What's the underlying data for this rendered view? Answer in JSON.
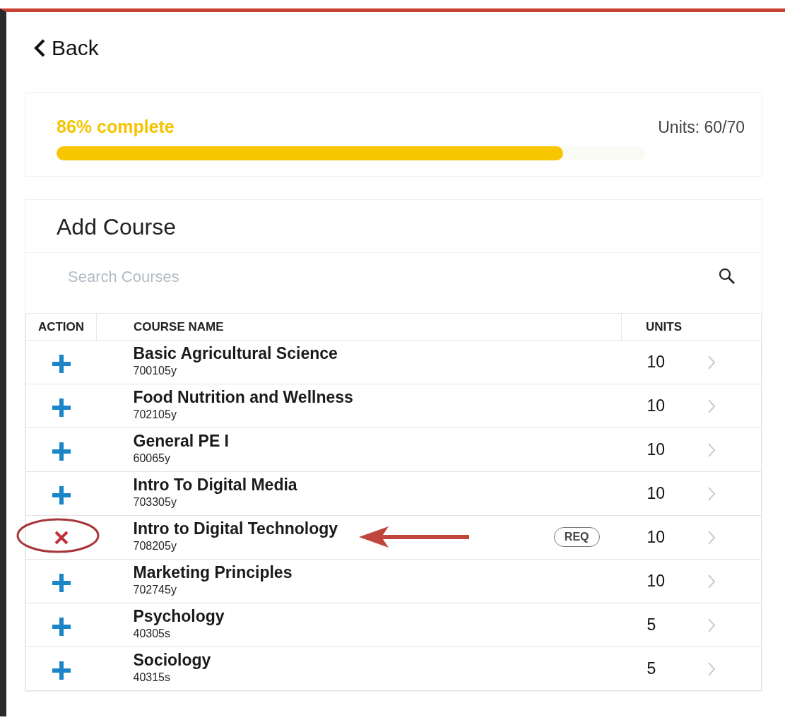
{
  "back": {
    "label": "Back"
  },
  "progress": {
    "label": "86% complete",
    "units": "Units: 60/70",
    "level": 0.86
  },
  "add_course": {
    "title": "Add Course",
    "search": {
      "placeholder": "Search Courses"
    },
    "table": {
      "columns": [
        "ACTION",
        "COURSE NAME",
        "UNITS"
      ],
      "rows": [
        {
          "kind": "add",
          "name": "Basic Agricultural Science",
          "code": "700105y",
          "units": "10",
          "marked": false
        },
        {
          "kind": "add",
          "name": "Food Nutrition and Wellness",
          "code": "702105y",
          "units": "10",
          "marked": false
        },
        {
          "kind": "add",
          "name": "General PE I",
          "code": "60065y",
          "units": "10",
          "marked": false
        },
        {
          "kind": "add",
          "name": "Intro To Digital Media",
          "code": "703305y",
          "units": "10",
          "marked": false
        },
        {
          "kind": "remove",
          "name": "Intro to Digital Technology",
          "code": "708205y",
          "badge": "REQ",
          "units": "10",
          "marked": true
        },
        {
          "kind": "add",
          "name": "Marketing Principles",
          "code": "702745y",
          "units": "10",
          "marked": false
        },
        {
          "kind": "add",
          "name": "Psychology",
          "code": "40305s",
          "units": "5",
          "marked": false
        },
        {
          "kind": "add",
          "name": "Sociology",
          "code": "40315s",
          "units": "5",
          "marked": false
        }
      ]
    }
  }
}
